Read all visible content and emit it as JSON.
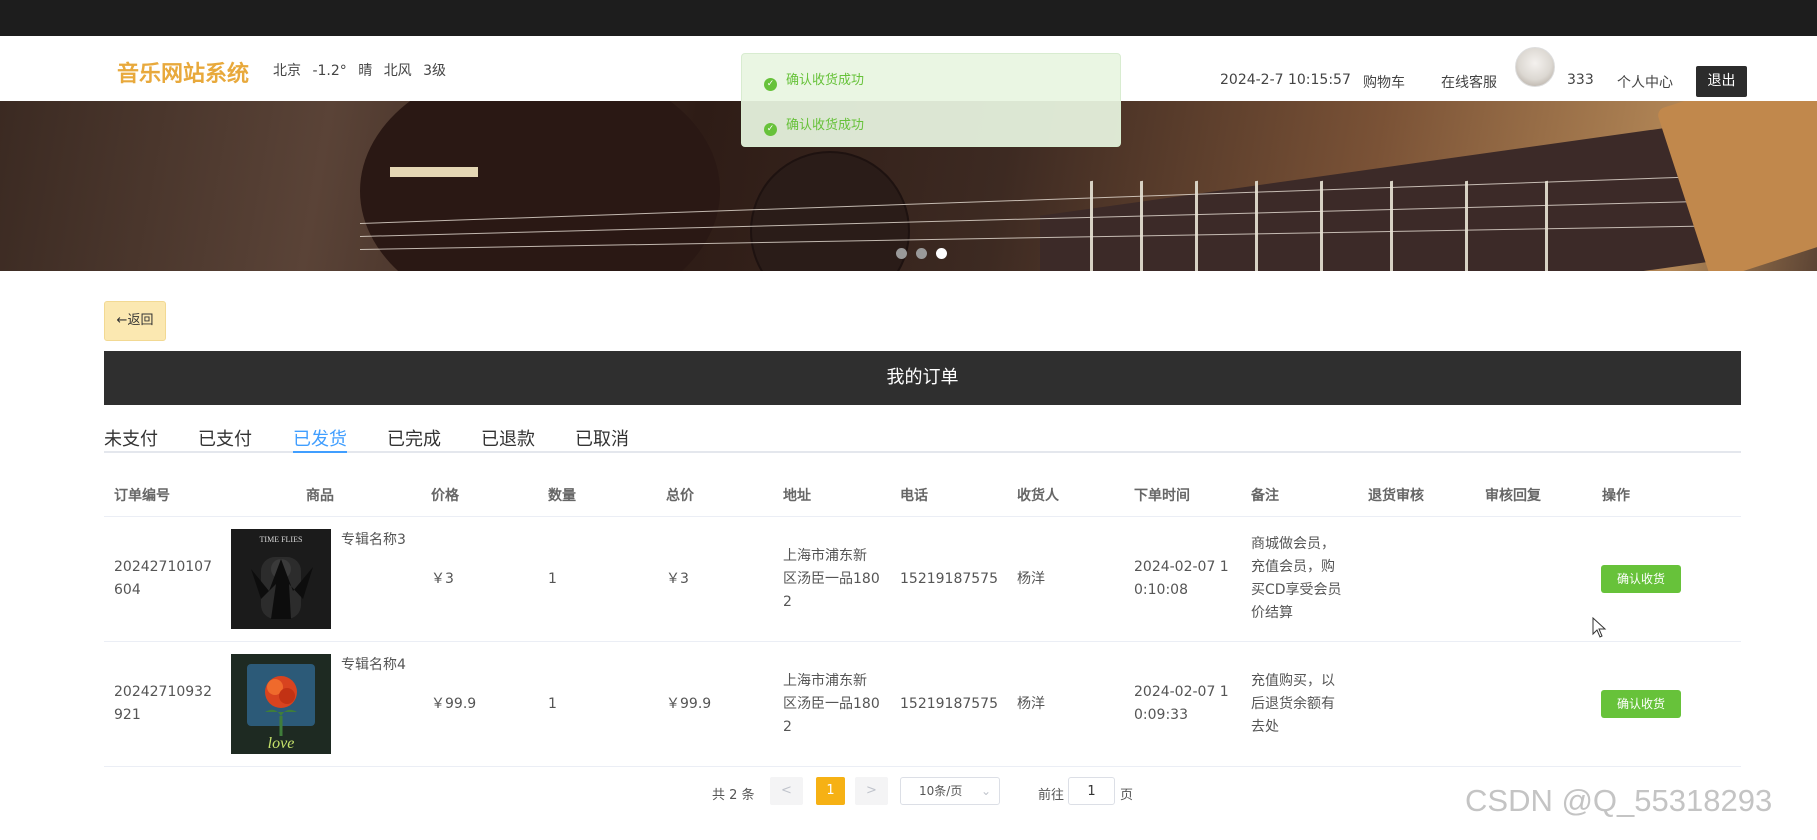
{
  "header": {
    "site_title": "音乐网站系统",
    "weather": [
      "北京",
      "-1.2°",
      "晴",
      "北风",
      "3级"
    ],
    "datetime": "2024-2-7 10:15:57",
    "cart": "购物车",
    "service": "在线客服",
    "username": "333",
    "user_center": "个人中心",
    "logout": "退出"
  },
  "toasts": [
    "确认收货成功",
    "确认收货成功"
  ],
  "back_label": "←返回",
  "page_title": "我的订单",
  "tabs": [
    "未支付",
    "已支付",
    "已发货",
    "已完成",
    "已退款",
    "已取消"
  ],
  "active_tab": "已发货",
  "columns": [
    "订单编号",
    "商品",
    "价格",
    "数量",
    "总价",
    "地址",
    "电话",
    "收货人",
    "下单时间",
    "备注",
    "退货审核",
    "审核回复",
    "操作"
  ],
  "orders": [
    {
      "order_no": [
        "20242710107",
        "604"
      ],
      "product": "专辑名称3",
      "cover": "TIME FLIES album cover",
      "price": "￥3",
      "qty": "1",
      "total": "￥3",
      "address": [
        "上海市浦东新",
        "区汤臣一品180",
        "2"
      ],
      "phone": "15219187575",
      "receiver": "杨洋",
      "order_time": [
        "2024-02-07 1",
        "0:10:08"
      ],
      "note": [
        "商城做会员，",
        "充值会员，购",
        "买CD享受会员",
        "价结算"
      ],
      "return_review": "",
      "review_reply": "",
      "action": "确认收货"
    },
    {
      "order_no": [
        "20242710932",
        "921"
      ],
      "product": "专辑名称4",
      "cover": "rose love album cover",
      "price": "￥99.9",
      "qty": "1",
      "total": "￥99.9",
      "address": [
        "上海市浦东新",
        "区汤臣一品180",
        "2"
      ],
      "phone": "15219187575",
      "receiver": "杨洋",
      "order_time": [
        "2024-02-07 1",
        "0:09:33"
      ],
      "note": [
        "充值购买，以",
        "后退货余额有",
        "去处"
      ],
      "return_review": "",
      "review_reply": "",
      "action": "确认收货"
    }
  ],
  "pagination": {
    "total": "共 2 条",
    "prev": "<",
    "current": "1",
    "next": ">",
    "page_size": "10条/页",
    "goto_prefix": "前往",
    "goto_value": "1",
    "goto_suffix": "页"
  },
  "watermark": "CSDN @Q_55318293",
  "colors": {
    "brand": "#e8a93c",
    "active_tab": "#409eff",
    "success": "#67c23a",
    "page_current": "#f6b114",
    "title_bar": "#2f2f2f"
  }
}
